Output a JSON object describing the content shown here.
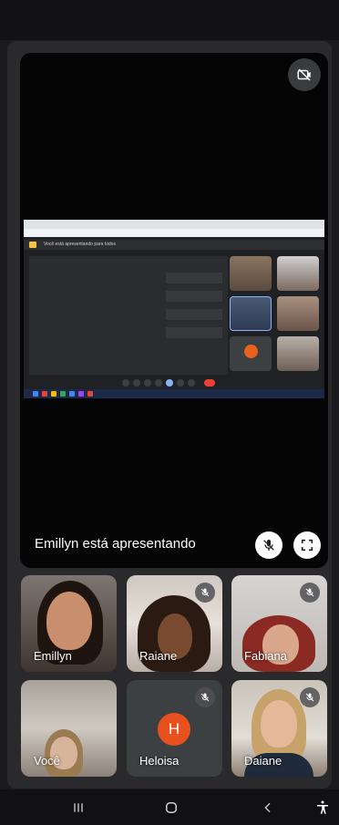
{
  "presentation": {
    "presenting_label": "Emillyn está apresentando",
    "shared_screen_banner": "Você está apresentando para todos",
    "icons": {
      "camera": "camera-flip-icon",
      "pin": "mic-off-icon",
      "fullscreen": "fullscreen-icon"
    }
  },
  "participants": [
    {
      "name": "Emillyn",
      "muted": false
    },
    {
      "name": "Raiane",
      "muted": true
    },
    {
      "name": "Fabiana",
      "muted": true
    },
    {
      "name": "Você",
      "muted": false
    },
    {
      "name": "Heloisa",
      "muted": true,
      "avatar_letter": "H",
      "avatar_color": "#e8501e"
    },
    {
      "name": "Daiane",
      "muted": true
    }
  ],
  "colors": {
    "accent": "#8ab4f8",
    "end_call": "#ea4335",
    "avatar": "#e8501e"
  },
  "nav": {
    "recent": "recent-apps-icon",
    "home": "home-icon",
    "back": "back-icon",
    "accessibility": "accessibility-icon"
  }
}
